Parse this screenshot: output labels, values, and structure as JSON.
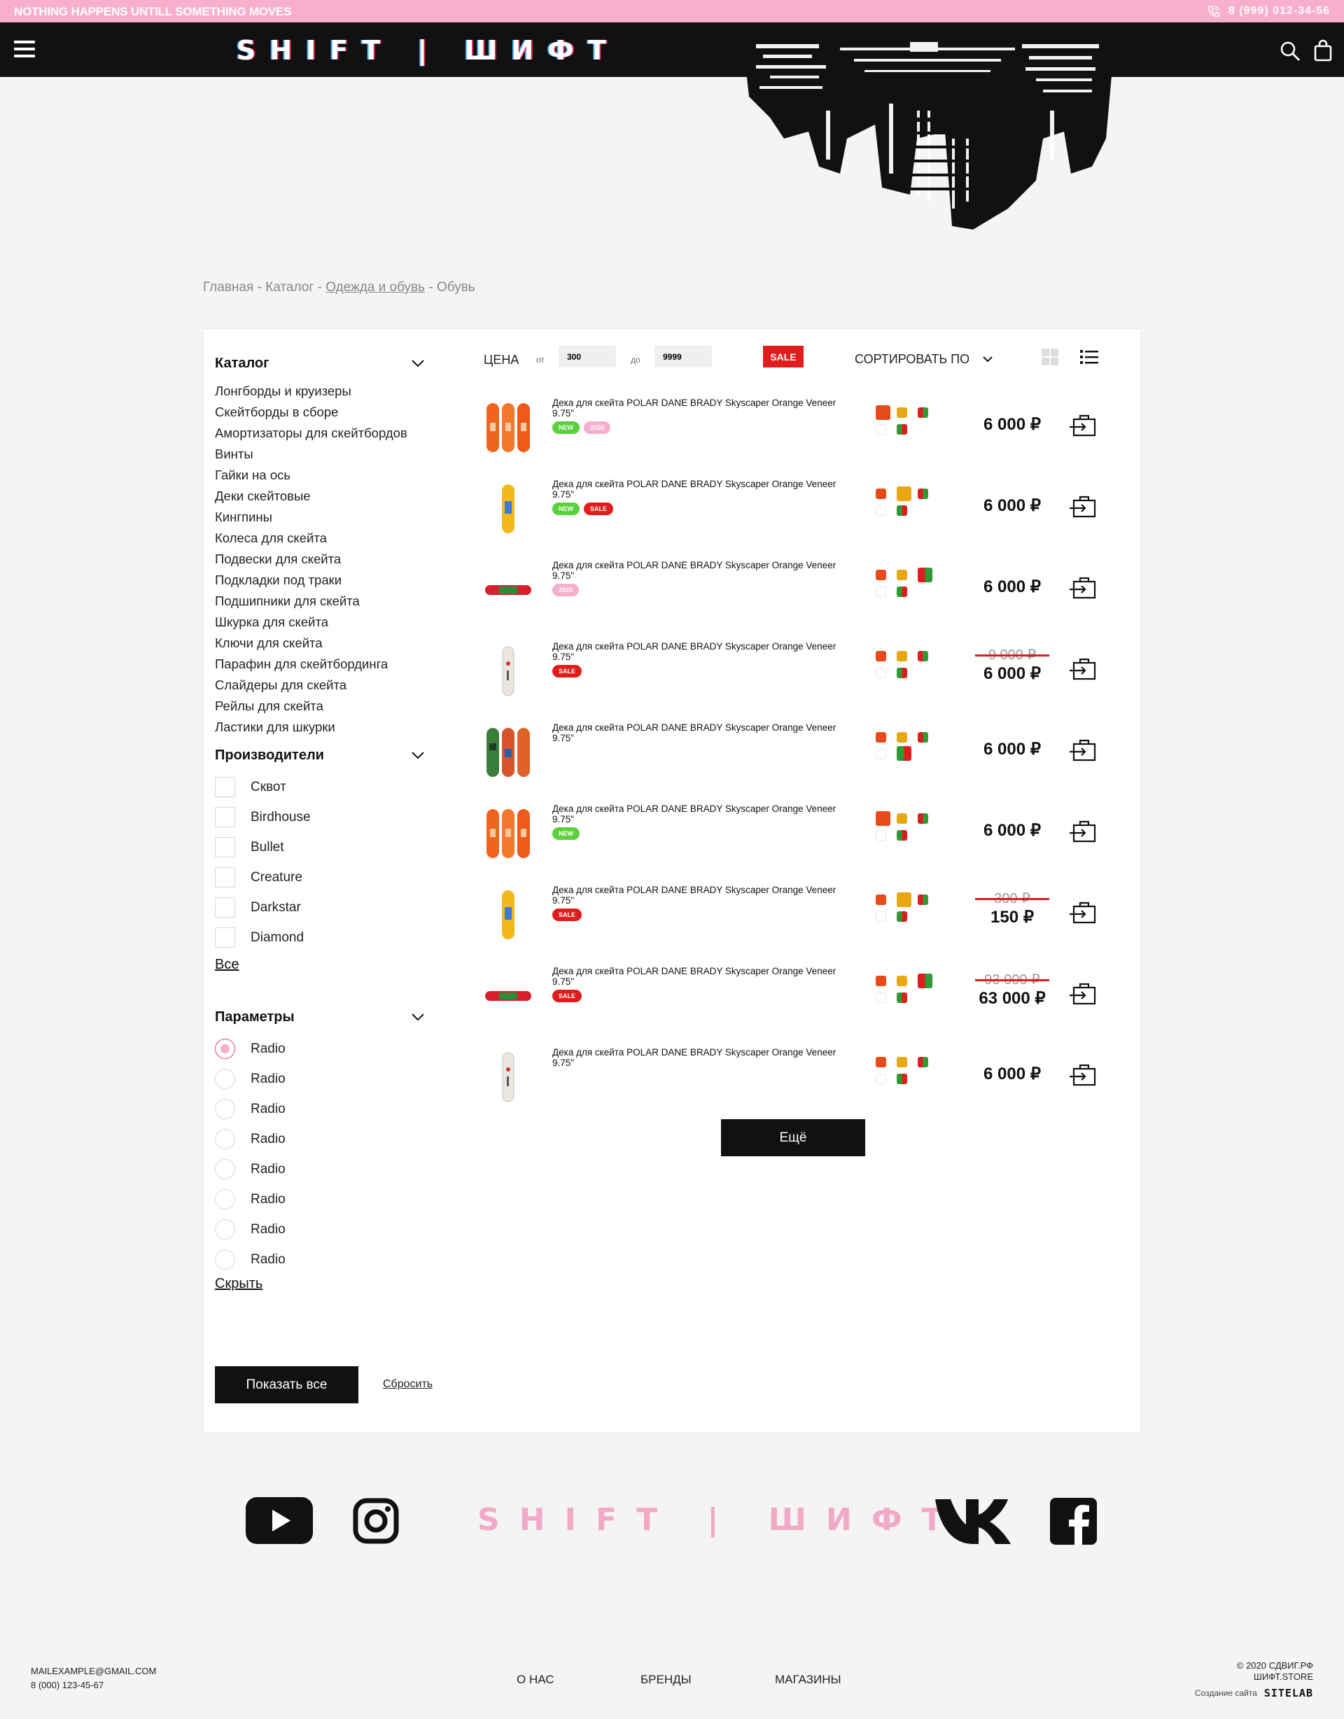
{
  "topbar": {
    "slogan": "NOTHING HAPPENS UNTILL SOMETHING MOVES",
    "phone": "8 (999) 012-34-56",
    "background": "#f7afcb"
  },
  "header": {
    "logo": "SHIFT | ШИФТ",
    "icons": [
      "menu-icon",
      "search-icon",
      "shopping-bag-icon"
    ]
  },
  "breadcrumb": [
    "Главная",
    "Каталог",
    "Одежда и обувь",
    "Обувь"
  ],
  "sidebar": {
    "catalog_title": "Каталог",
    "catalog_items": [
      "Лонгборды и круизеры",
      "Скейтборды в сборе",
      "Амортизаторы для скейтбордов",
      "Винты",
      "Гайки на ось",
      "Деки скейтовые",
      "Кингпины",
      "Колеса для скейта",
      "Подвески для скейта",
      "Подкладки под траки",
      "Подшипники для скейта",
      "Шкурка для скейта",
      "Ключи для скейта",
      "Парафин для скейтбординга",
      "Слайдеры для скейта",
      "Рейлы для скейта",
      "Ластики для шкурки"
    ],
    "manufacturers_title": "Производители",
    "manufacturers": [
      "Сквот",
      "Birdhouse",
      "Bullet",
      "Creature",
      "Darkstar",
      "Diamond"
    ],
    "all_link": "Все",
    "params_title": "Параметры",
    "params": [
      "Radio",
      "Radio",
      "Radio",
      "Radio",
      "Radio",
      "Radio",
      "Radio",
      "Radio"
    ],
    "params_selected_index": 0,
    "hide_link": "Скрыть",
    "show_all_button": "Показать все",
    "reset_link": "Сбросить"
  },
  "filters": {
    "price_label": "ЦЕНА",
    "from_label": "от",
    "from_value": "300",
    "to_label": "до",
    "to_value": "9999",
    "sale_button": "SALE",
    "sort_label": "СОРТИРОВАТЬ ПО",
    "view_mode": "list"
  },
  "products": [
    {
      "name": "Дека для скейта POLAR DANE BRADY Skyscaper Orange Veneer 9.75\"",
      "badges": [
        "NEW",
        "2020"
      ],
      "price": "6 000 ₽",
      "old_price": "",
      "image": "three-orange-decks",
      "selected_swatch": 0
    },
    {
      "name": "Дека для скейта POLAR DANE BRADY Skyscaper Orange Veneer 9.75\"",
      "badges": [
        "NEW",
        "SALE"
      ],
      "price": "6 000 ₽",
      "old_price": "",
      "image": "yellow-deck",
      "selected_swatch": 1
    },
    {
      "name": "Дека для скейта POLAR DANE BRADY Skyscaper Orange Veneer 9.75\"",
      "badges": [
        "2020"
      ],
      "price": "6 000 ₽",
      "old_price": "",
      "image": "red-deck-side",
      "selected_swatch": 2
    },
    {
      "name": "Дека для скейта POLAR DANE BRADY Skyscaper Orange Veneer 9.75\"",
      "badges": [
        "SALE"
      ],
      "price": "6 000 ₽",
      "old_price": "9 000 ₽",
      "image": "white-deck",
      "selected_swatch": -1
    },
    {
      "name": "Дека для скейта POLAR DANE BRADY Skyscaper Orange Veneer 9.75\"",
      "badges": [],
      "price": "6 000 ₽",
      "old_price": "",
      "image": "camo-decks",
      "selected_swatch": 3
    },
    {
      "name": "Дека для скейта POLAR DANE BRADY Skyscaper Orange Veneer 9.75\"",
      "badges": [
        "NEW"
      ],
      "price": "6 000 ₽",
      "old_price": "",
      "image": "three-orange-decks",
      "selected_swatch": 0
    },
    {
      "name": "Дека для скейта POLAR DANE BRADY Skyscaper Orange Veneer 9.75\"",
      "badges": [
        "SALE"
      ],
      "price": "150 ₽",
      "old_price": "300 ₽",
      "image": "yellow-deck",
      "selected_swatch": 1
    },
    {
      "name": "Дека для скейта POLAR DANE BRADY Skyscaper Orange Veneer 9.75\"",
      "badges": [
        "SALE"
      ],
      "price": "63 000 ₽",
      "old_price": "93 000 ₽",
      "image": "red-deck-side",
      "selected_swatch": 2
    },
    {
      "name": "Дека для скейта POLAR DANE BRADY Skyscaper Orange Veneer 9.75\"",
      "badges": [],
      "price": "6 000 ₽",
      "old_price": "",
      "image": "white-deck",
      "selected_swatch": -1
    }
  ],
  "badge_colors": {
    "NEW": "#5cd03c",
    "2020": "#f7afcb",
    "SALE": "#e01c1c"
  },
  "swatch_colors": [
    "#e84b1b",
    "#e8a814",
    "red-green",
    "white",
    "green-red"
  ],
  "more_button": "Ещё",
  "footer": {
    "logo": "SHIFT | ШИФТ",
    "socials": [
      "youtube-icon",
      "instagram-icon",
      "vk-icon",
      "facebook-icon"
    ],
    "email": "MAILEXAMPLE@GMAIL.COM",
    "phone": "8 (000) 123-45-67",
    "nav": [
      "О НАС",
      "БРЕНДЫ",
      "МАГАЗИНЫ"
    ],
    "copyright_line1": "© 2020 СДВИГ.РФ",
    "copyright_line2": "ШИФТ.STORE",
    "made_by_label": "Создание сайта",
    "made_by_brand": "SITELAB"
  }
}
